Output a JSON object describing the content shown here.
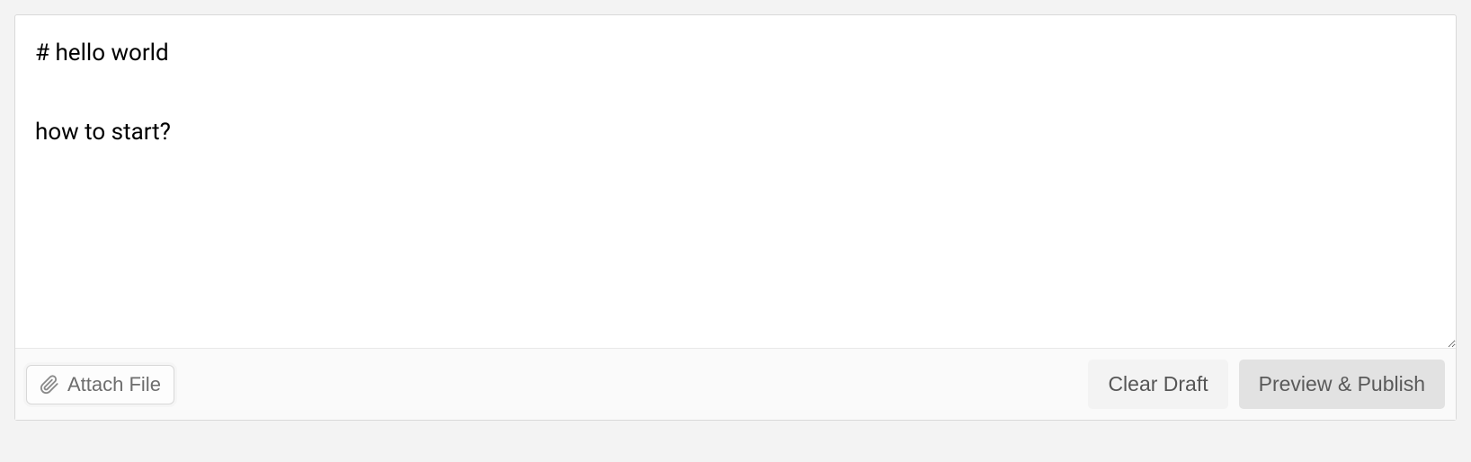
{
  "editor": {
    "content": "# hello world\n\nhow to start?"
  },
  "toolbar": {
    "attach_label": "Attach File",
    "clear_label": "Clear Draft",
    "publish_label": "Preview & Publish"
  }
}
